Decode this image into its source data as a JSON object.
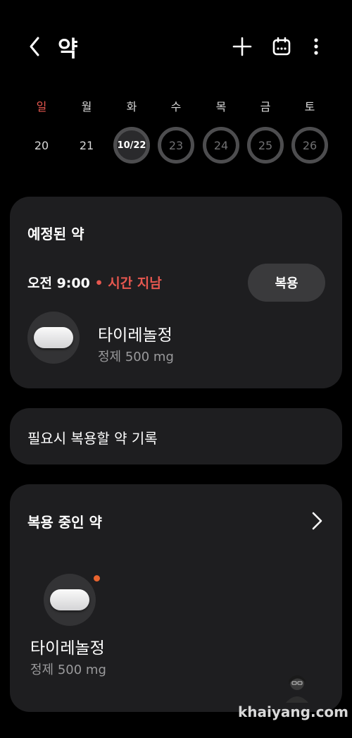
{
  "header": {
    "title": "약"
  },
  "week": {
    "days": [
      {
        "name": "일",
        "num": "20"
      },
      {
        "name": "월",
        "num": "21"
      },
      {
        "name": "화",
        "num": "10/22"
      },
      {
        "name": "수",
        "num": "23"
      },
      {
        "name": "목",
        "num": "24"
      },
      {
        "name": "금",
        "num": "25"
      },
      {
        "name": "토",
        "num": "26"
      }
    ]
  },
  "scheduled": {
    "title": "예정된 약",
    "time": "오전 9:00",
    "status": "• 시간 지남",
    "take_label": "복용",
    "med": {
      "name": "타이레놀정",
      "detail": "정제 500 mg"
    }
  },
  "as_needed": {
    "label": "필요시 복용할 약 기록"
  },
  "current": {
    "title": "복용 중인 약",
    "med": {
      "name": "타이레놀정",
      "detail": "정제 500 mg"
    }
  },
  "watermark": "khaiyang.com",
  "colors": {
    "accent_red": "#e6574f",
    "dot_orange": "#e9642f"
  },
  "icons": [
    "back-arrow-icon",
    "plus-icon",
    "calendar-icon",
    "more-vert-icon",
    "pill-icon",
    "chevron-right-icon"
  ]
}
